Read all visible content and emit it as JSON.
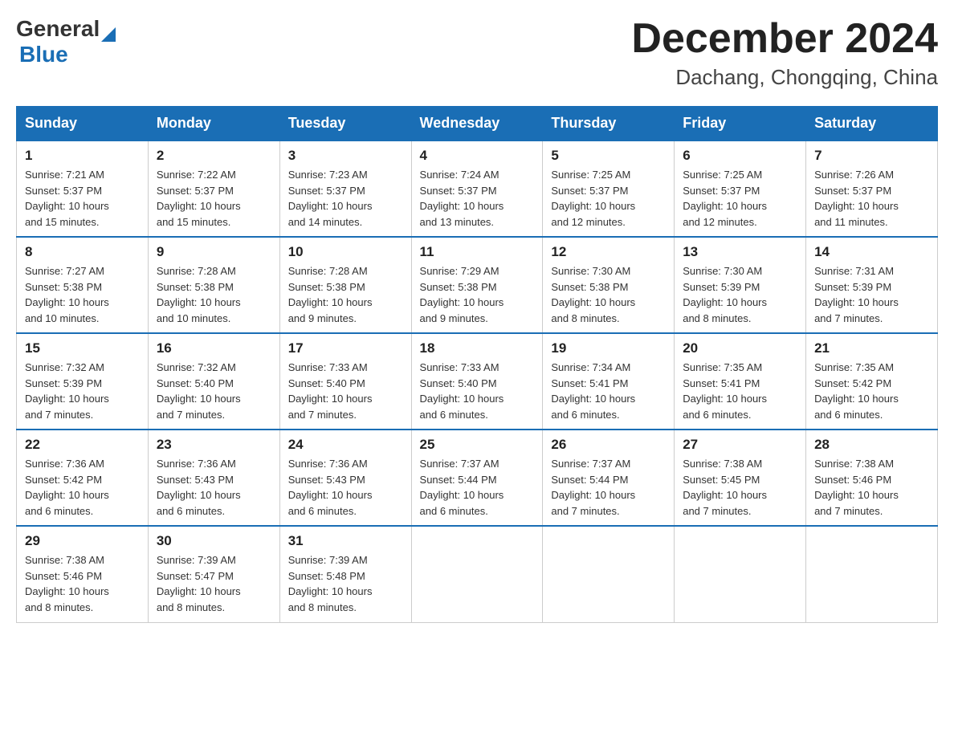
{
  "logo": {
    "general": "General",
    "blue": "Blue"
  },
  "title": {
    "month": "December 2024",
    "location": "Dachang, Chongqing, China"
  },
  "header_days": [
    "Sunday",
    "Monday",
    "Tuesday",
    "Wednesday",
    "Thursday",
    "Friday",
    "Saturday"
  ],
  "weeks": [
    [
      {
        "day": "1",
        "info": "Sunrise: 7:21 AM\nSunset: 5:37 PM\nDaylight: 10 hours\nand 15 minutes."
      },
      {
        "day": "2",
        "info": "Sunrise: 7:22 AM\nSunset: 5:37 PM\nDaylight: 10 hours\nand 15 minutes."
      },
      {
        "day": "3",
        "info": "Sunrise: 7:23 AM\nSunset: 5:37 PM\nDaylight: 10 hours\nand 14 minutes."
      },
      {
        "day": "4",
        "info": "Sunrise: 7:24 AM\nSunset: 5:37 PM\nDaylight: 10 hours\nand 13 minutes."
      },
      {
        "day": "5",
        "info": "Sunrise: 7:25 AM\nSunset: 5:37 PM\nDaylight: 10 hours\nand 12 minutes."
      },
      {
        "day": "6",
        "info": "Sunrise: 7:25 AM\nSunset: 5:37 PM\nDaylight: 10 hours\nand 12 minutes."
      },
      {
        "day": "7",
        "info": "Sunrise: 7:26 AM\nSunset: 5:37 PM\nDaylight: 10 hours\nand 11 minutes."
      }
    ],
    [
      {
        "day": "8",
        "info": "Sunrise: 7:27 AM\nSunset: 5:38 PM\nDaylight: 10 hours\nand 10 minutes."
      },
      {
        "day": "9",
        "info": "Sunrise: 7:28 AM\nSunset: 5:38 PM\nDaylight: 10 hours\nand 10 minutes."
      },
      {
        "day": "10",
        "info": "Sunrise: 7:28 AM\nSunset: 5:38 PM\nDaylight: 10 hours\nand 9 minutes."
      },
      {
        "day": "11",
        "info": "Sunrise: 7:29 AM\nSunset: 5:38 PM\nDaylight: 10 hours\nand 9 minutes."
      },
      {
        "day": "12",
        "info": "Sunrise: 7:30 AM\nSunset: 5:38 PM\nDaylight: 10 hours\nand 8 minutes."
      },
      {
        "day": "13",
        "info": "Sunrise: 7:30 AM\nSunset: 5:39 PM\nDaylight: 10 hours\nand 8 minutes."
      },
      {
        "day": "14",
        "info": "Sunrise: 7:31 AM\nSunset: 5:39 PM\nDaylight: 10 hours\nand 7 minutes."
      }
    ],
    [
      {
        "day": "15",
        "info": "Sunrise: 7:32 AM\nSunset: 5:39 PM\nDaylight: 10 hours\nand 7 minutes."
      },
      {
        "day": "16",
        "info": "Sunrise: 7:32 AM\nSunset: 5:40 PM\nDaylight: 10 hours\nand 7 minutes."
      },
      {
        "day": "17",
        "info": "Sunrise: 7:33 AM\nSunset: 5:40 PM\nDaylight: 10 hours\nand 7 minutes."
      },
      {
        "day": "18",
        "info": "Sunrise: 7:33 AM\nSunset: 5:40 PM\nDaylight: 10 hours\nand 6 minutes."
      },
      {
        "day": "19",
        "info": "Sunrise: 7:34 AM\nSunset: 5:41 PM\nDaylight: 10 hours\nand 6 minutes."
      },
      {
        "day": "20",
        "info": "Sunrise: 7:35 AM\nSunset: 5:41 PM\nDaylight: 10 hours\nand 6 minutes."
      },
      {
        "day": "21",
        "info": "Sunrise: 7:35 AM\nSunset: 5:42 PM\nDaylight: 10 hours\nand 6 minutes."
      }
    ],
    [
      {
        "day": "22",
        "info": "Sunrise: 7:36 AM\nSunset: 5:42 PM\nDaylight: 10 hours\nand 6 minutes."
      },
      {
        "day": "23",
        "info": "Sunrise: 7:36 AM\nSunset: 5:43 PM\nDaylight: 10 hours\nand 6 minutes."
      },
      {
        "day": "24",
        "info": "Sunrise: 7:36 AM\nSunset: 5:43 PM\nDaylight: 10 hours\nand 6 minutes."
      },
      {
        "day": "25",
        "info": "Sunrise: 7:37 AM\nSunset: 5:44 PM\nDaylight: 10 hours\nand 6 minutes."
      },
      {
        "day": "26",
        "info": "Sunrise: 7:37 AM\nSunset: 5:44 PM\nDaylight: 10 hours\nand 7 minutes."
      },
      {
        "day": "27",
        "info": "Sunrise: 7:38 AM\nSunset: 5:45 PM\nDaylight: 10 hours\nand 7 minutes."
      },
      {
        "day": "28",
        "info": "Sunrise: 7:38 AM\nSunset: 5:46 PM\nDaylight: 10 hours\nand 7 minutes."
      }
    ],
    [
      {
        "day": "29",
        "info": "Sunrise: 7:38 AM\nSunset: 5:46 PM\nDaylight: 10 hours\nand 8 minutes."
      },
      {
        "day": "30",
        "info": "Sunrise: 7:39 AM\nSunset: 5:47 PM\nDaylight: 10 hours\nand 8 minutes."
      },
      {
        "day": "31",
        "info": "Sunrise: 7:39 AM\nSunset: 5:48 PM\nDaylight: 10 hours\nand 8 minutes."
      },
      null,
      null,
      null,
      null
    ]
  ]
}
